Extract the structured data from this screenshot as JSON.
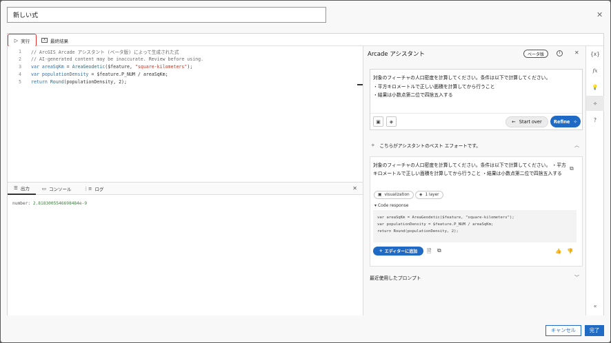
{
  "dialog": {
    "title_value": "新しい式",
    "close_icon": "close-icon"
  },
  "toolbar": {
    "run_label": "実行",
    "result_tab_label": "最終結果"
  },
  "editor": {
    "lines": [
      {
        "n": "1",
        "text": "// ArcGIS Arcade アシスタント (ベータ版) によって生成された式"
      },
      {
        "n": "2",
        "text": "// AI-generated content may be inaccurate. Review before using."
      },
      {
        "n": "3",
        "kw": "var",
        "id": "areaSqKm",
        "eq": " = ",
        "fn": "AreaGeodetic",
        "args1": "($feature, ",
        "str": "\"square-kilometers\"",
        "tail": ");"
      },
      {
        "n": "4",
        "kw": "var",
        "id": "populationDensity",
        "eq": " = ",
        "rest": "$feature.P_NUM / areaSqKm;"
      },
      {
        "n": "5",
        "kw": "return",
        "fn": "Round",
        "rest": "(populationDensity, 2);"
      }
    ]
  },
  "output": {
    "tabs": [
      "出力",
      "コンソール",
      "ログ"
    ],
    "result_prefix": "number: ",
    "result_value": "2.8183005546698484e-9"
  },
  "assistant": {
    "title": "Arcade アシスタント",
    "beta_badge": "ベータ版",
    "prompt_lines": [
      "対象のフィーチャの人口密度を計算してください。条件は以下で計算してください。",
      "・平方キロメートルで正しい面積を計算してから行うこと",
      "・結果は小数点第二位で四捨五入する"
    ],
    "start_over_label": "Start over",
    "refine_label": "Refine",
    "best_effort_label": "こちらがアシスタントのベスト エフォートです。",
    "response_text": "対象のフィーチャの人口密度を計算してください。条件は以下で計算してください。 ・平方キロメートルで正しい面積を計算してから行うこと ・結果は小数点第二位で四捨五入する",
    "chips": [
      "visualization",
      "1 layer"
    ],
    "code_response_label": "▾ Code response",
    "code_response": "var areaSqKm = AreaGeodetic($feature, \"square-kilometers\");\nvar populationDensity = $feature.P_NUM / areaSqKm;\nreturn Round(populationDensity, 2);",
    "add_to_editor_label": "エディターに追加",
    "recent_prompts_label": "最近使用したプロンプト"
  },
  "rail": {
    "icons": [
      "variables-icon",
      "functions-icon",
      "suggestions-icon",
      "assistant-icon",
      "help-icon",
      "collapse-icon"
    ]
  },
  "footer": {
    "cancel_label": "キャンセル",
    "done_label": "完了"
  },
  "colors": {
    "accent": "#1f6ac4",
    "highlight_border": "#e0302c"
  }
}
